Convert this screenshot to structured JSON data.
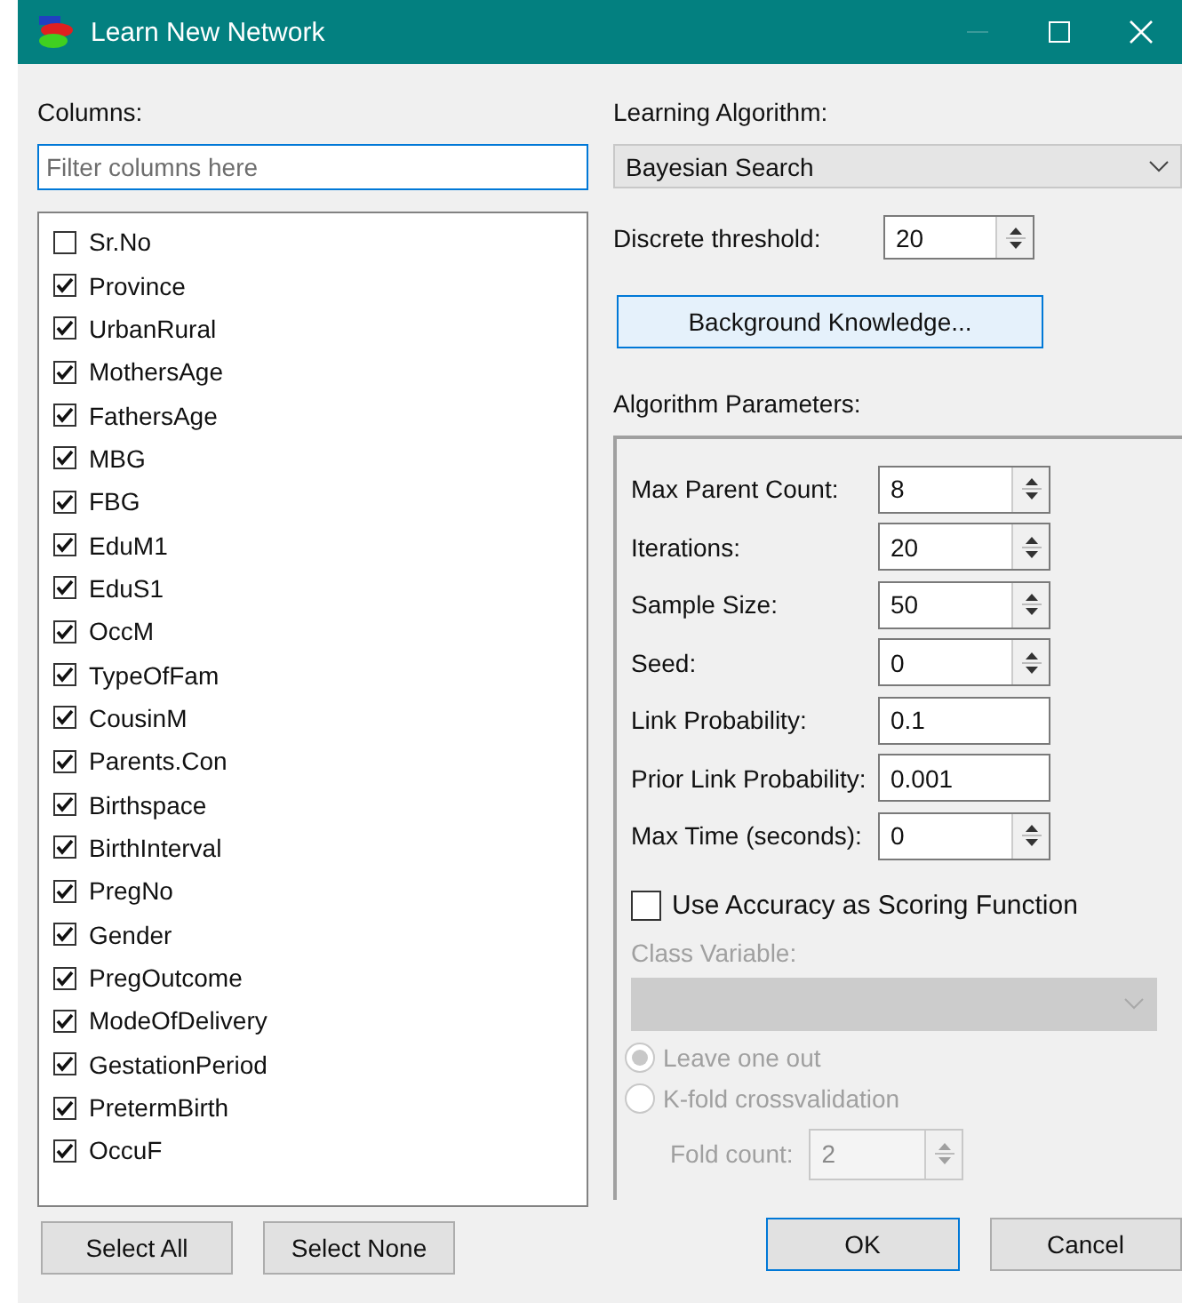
{
  "window": {
    "title": "Learn New Network"
  },
  "columns": {
    "label": "Columns:",
    "filter": {
      "placeholder": "Filter columns here"
    },
    "items": [
      {
        "label": "Sr.No",
        "checked": false
      },
      {
        "label": "Province",
        "checked": true
      },
      {
        "label": "UrbanRural",
        "checked": true
      },
      {
        "label": "MothersAge",
        "checked": true
      },
      {
        "label": "FathersAge",
        "checked": true
      },
      {
        "label": "MBG",
        "checked": true
      },
      {
        "label": "FBG",
        "checked": true
      },
      {
        "label": "EduM1",
        "checked": true
      },
      {
        "label": "EduS1",
        "checked": true
      },
      {
        "label": "OccM",
        "checked": true
      },
      {
        "label": "TypeOfFam",
        "checked": true
      },
      {
        "label": "CousinM",
        "checked": true
      },
      {
        "label": "Parents.Con",
        "checked": true
      },
      {
        "label": "Birthspace",
        "checked": true
      },
      {
        "label": "BirthInterval",
        "checked": true
      },
      {
        "label": "PregNo",
        "checked": true
      },
      {
        "label": "Gender",
        "checked": true
      },
      {
        "label": "PregOutcome",
        "checked": true
      },
      {
        "label": "ModeOfDelivery",
        "checked": true
      },
      {
        "label": "GestationPeriod",
        "checked": true
      },
      {
        "label": "PretermBirth",
        "checked": true
      },
      {
        "label": "OccuF",
        "checked": true
      }
    ]
  },
  "algorithm": {
    "label": "Learning Algorithm:",
    "value": "Bayesian Search"
  },
  "threshold": {
    "label": "Discrete threshold:",
    "value": "20"
  },
  "background_button": "Background Knowledge...",
  "parameters": {
    "label": "Algorithm Parameters:",
    "fields": [
      {
        "label": "Max Parent Count:",
        "value": "8",
        "kind": "spin"
      },
      {
        "label": "Iterations:",
        "value": "20",
        "kind": "spin"
      },
      {
        "label": "Sample Size:",
        "value": "50",
        "kind": "spin"
      },
      {
        "label": "Seed:",
        "value": "0",
        "kind": "spin"
      },
      {
        "label": "Link Probability:",
        "value": "0.1",
        "kind": "text"
      },
      {
        "label": "Prior Link Probability:",
        "value": "0.001",
        "kind": "text"
      },
      {
        "label": "Max Time (seconds):",
        "value": "0",
        "kind": "spin"
      }
    ],
    "accuracy": {
      "label": "Use Accuracy as Scoring Function",
      "checked": false
    },
    "class_variable": {
      "label": "Class Variable:",
      "disabled": true
    },
    "radios": [
      {
        "label": "Leave one out",
        "selected": true,
        "disabled": true
      },
      {
        "label": "K-fold crossvalidation",
        "selected": false,
        "disabled": true
      }
    ],
    "fold_count": {
      "label": "Fold count:",
      "value": "2",
      "disabled": true
    }
  },
  "buttons_left": [
    "Select All",
    "Select None"
  ],
  "buttons_right": [
    "OK",
    "Cancel"
  ]
}
